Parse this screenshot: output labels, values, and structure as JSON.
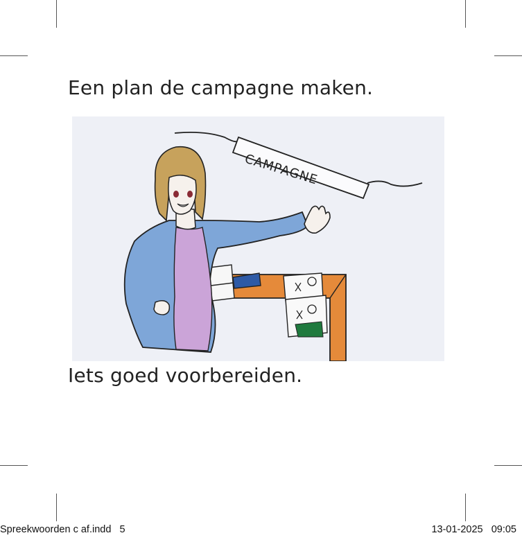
{
  "page": {
    "title": "Een plan de campagne maken.",
    "caption": "Iets goed voorbereiden.",
    "illustration": {
      "banner_text": "CAMPAGNE"
    },
    "slug": {
      "file": "Spreekwoorden c af.indd   5",
      "datetime": "13-01-2025   09:05"
    }
  }
}
